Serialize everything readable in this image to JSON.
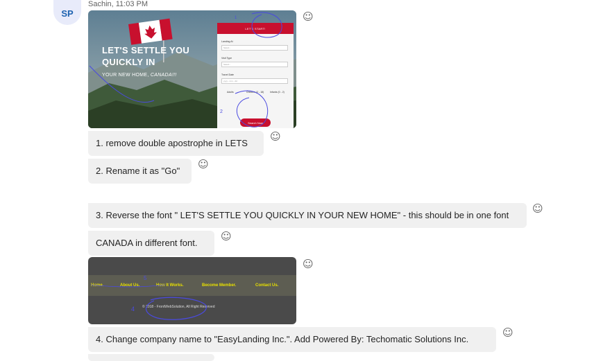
{
  "sender": {
    "initials": "SP",
    "meta": "Sachin, 11:03 PM"
  },
  "screenshot1": {
    "hero_title": "LET'S SETTLE YOU QUICKLY IN",
    "hero_sub_prefix": "YOUR NEW HOME, ",
    "hero_sub_emphasis": "CANADA!!!",
    "form_header": "LET'S START!",
    "fields": [
      {
        "label": "Landing At",
        "value": "Select..."
      },
      {
        "label": "Visit Type",
        "value": "Select..."
      },
      {
        "label": "Travel Date",
        "value": "yyyy - mm - dd"
      }
    ],
    "travellers": {
      "adults": "Adults",
      "children": "Children (2 - 18)",
      "infants": "Infants (0 - 2)"
    },
    "button": "Search Now",
    "annotations": [
      "1",
      "2"
    ]
  },
  "messages": [
    {
      "id": "m1",
      "text": "1. remove double apostrophe in LETS"
    },
    {
      "id": "m2",
      "text": "2. Rename it as \"Go\""
    },
    {
      "id": "m3",
      "text": "3. Reverse the font \" LET'S SETTLE YOU QUICKLY IN YOUR NEW HOME\" - this should be in one font"
    },
    {
      "id": "m4",
      "text": "CANADA in different font."
    },
    {
      "id": "m5",
      "text": "4. Change company name to \"EasyLanding Inc.\". Add Powered By: Techomatic Solutions Inc."
    }
  ],
  "screenshot2": {
    "nav": [
      "Home.",
      "About Us.",
      "How It Works.",
      "Become Member.",
      "Contact Us."
    ],
    "copyright": "© 2018 - FrontWebSolution, All Right Reserved",
    "annotations": [
      "5",
      "4"
    ]
  },
  "react_icon": "smiley-icon"
}
